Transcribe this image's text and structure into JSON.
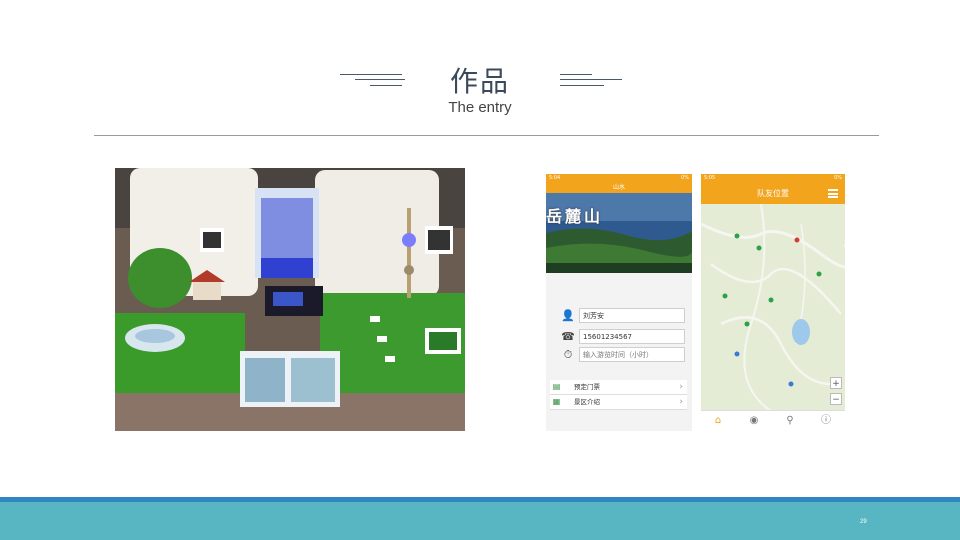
{
  "slide": {
    "title_zh": "作品",
    "title_en": "The entry",
    "page_number": "29"
  },
  "app_left": {
    "status_left": "5:04",
    "status_right": "0%",
    "topbar_title": "山水",
    "banner_title": "岳麓山",
    "fields": [
      {
        "icon": "user-icon",
        "value": "刘芳安"
      },
      {
        "icon": "phone-icon",
        "value": "15601234567"
      },
      {
        "icon": "timer-icon",
        "value": "输入游览时间（小时）"
      }
    ],
    "menu": [
      {
        "icon": "ticket-icon",
        "label": "预定门票"
      },
      {
        "icon": "info-icon",
        "label": "景区介绍"
      }
    ]
  },
  "app_right": {
    "status_left": "5:05",
    "status_right": "0%",
    "topbar_title": "队友位置",
    "zoom_in": "+",
    "zoom_out": "−"
  },
  "colors": {
    "accent": "#f2a41d",
    "footer": "#58b6c2",
    "footer_stripe": "#2f86c0"
  }
}
